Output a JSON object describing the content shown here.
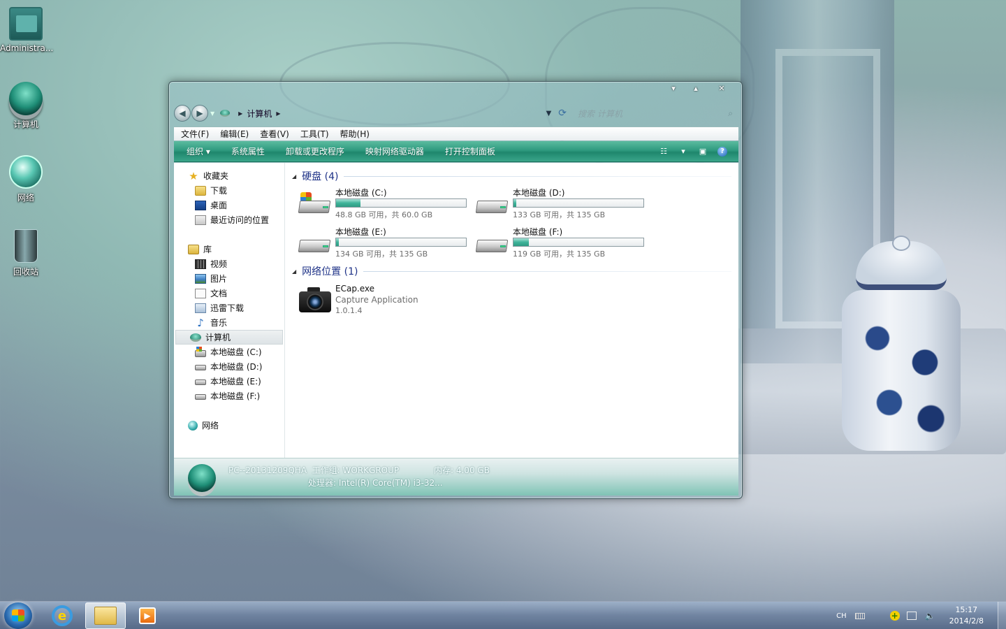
{
  "desktop": {
    "icons": [
      {
        "label": "Administra..."
      },
      {
        "label": "计算机"
      },
      {
        "label": "网络"
      },
      {
        "label": "回收站"
      }
    ]
  },
  "window": {
    "caption_buttons": [
      "▾",
      "▴",
      "✕"
    ],
    "breadcrumb": {
      "current": "计算机"
    },
    "search": {
      "placeholder": "搜索 计算机"
    },
    "menu": [
      "文件(F)",
      "编辑(E)",
      "查看(V)",
      "工具(T)",
      "帮助(H)"
    ],
    "toolbar": [
      "组织 ▾",
      "系统属性",
      "卸载或更改程序",
      "映射网络驱动器",
      "打开控制面板"
    ],
    "nav": {
      "favorites": {
        "label": "收藏夹",
        "items": [
          "下载",
          "桌面",
          "最近访问的位置"
        ]
      },
      "libraries": {
        "label": "库",
        "items": [
          "视频",
          "图片",
          "文档",
          "迅雷下载",
          "音乐"
        ]
      },
      "computer": {
        "label": "计算机",
        "items": [
          "本地磁盘 (C:)",
          "本地磁盘 (D:)",
          "本地磁盘 (E:)",
          "本地磁盘 (F:)"
        ]
      },
      "network": {
        "label": "网络"
      }
    },
    "groups": {
      "hard_disks": {
        "header": "硬盘 (4)",
        "drives": [
          {
            "name": "本地磁盘 (C:)",
            "free_text": "48.8 GB 可用，共 60.0 GB",
            "used_fraction": 0.19,
            "windows": true
          },
          {
            "name": "本地磁盘 (D:)",
            "free_text": "133 GB 可用，共 135 GB",
            "used_fraction": 0.01,
            "windows": false
          },
          {
            "name": "本地磁盘 (E:)",
            "free_text": "134 GB 可用，共 135 GB",
            "used_fraction": 0.01,
            "windows": false
          },
          {
            "name": "本地磁盘 (F:)",
            "free_text": "119 GB 可用，共 135 GB",
            "used_fraction": 0.12,
            "windows": false
          }
        ]
      },
      "network_locations": {
        "header": "网络位置 (1)",
        "item": {
          "name": "ECap.exe",
          "description": "Capture Application",
          "version": "1.0.1.4"
        }
      }
    },
    "details": {
      "computer_name": "PC--20131209QHA",
      "workgroup": "工作组: WORKGROUP",
      "memory": "内存: 4.00 GB",
      "processor": "处理器: Intel(R) Core(TM) i3-32..."
    }
  },
  "taskbar": {
    "tray": {
      "language": "CH",
      "time": "15:17",
      "date": "2014/2/8"
    }
  },
  "colors": {
    "accent_green": "#2f9a7f",
    "group_header_blue": "#1e3287"
  }
}
